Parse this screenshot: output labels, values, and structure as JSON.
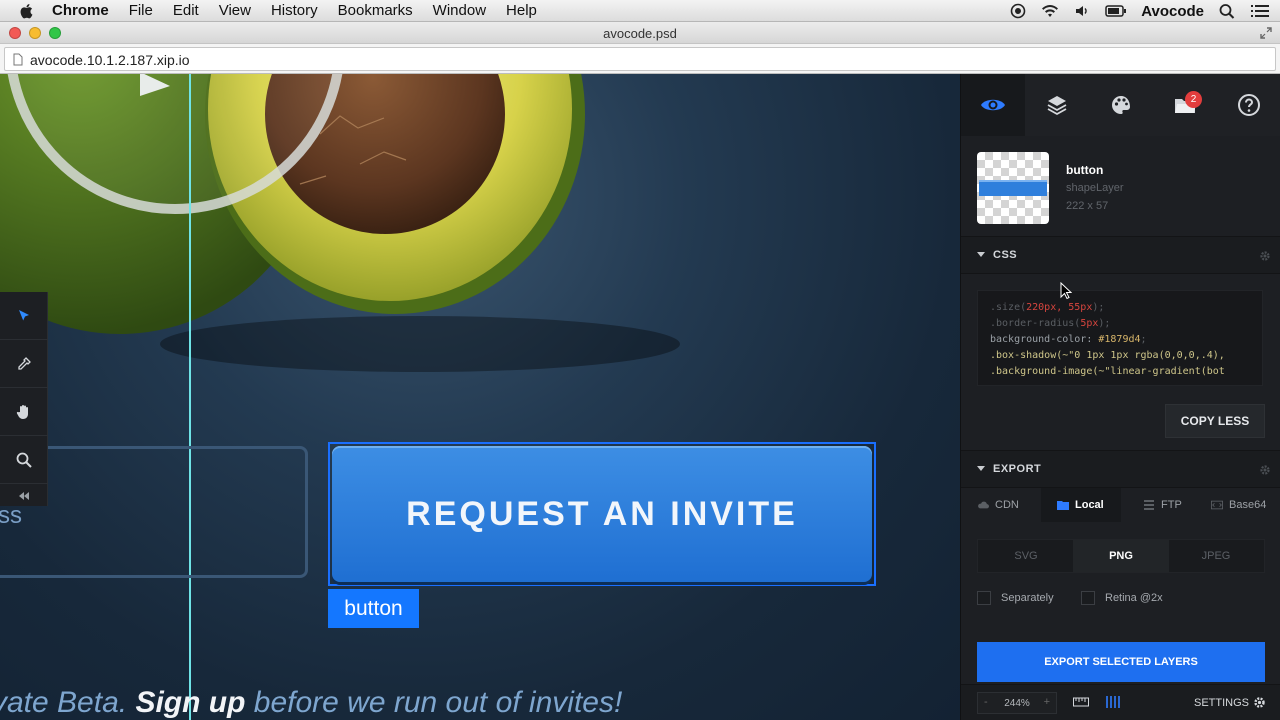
{
  "menubar": {
    "app_name": "Chrome",
    "items": [
      "File",
      "Edit",
      "View",
      "History",
      "Bookmarks",
      "Window",
      "Help"
    ],
    "user_name": "Avocode",
    "tray_icons": [
      "screen-record-icon",
      "wifi-icon",
      "volume-icon",
      "battery-icon",
      "search-icon",
      "list-icon"
    ]
  },
  "window": {
    "title": "avocode.psd",
    "url": "avocode.10.1.2.187.xip.io"
  },
  "canvas": {
    "input_partial_text": "ss",
    "button_label": "REQUEST AN INVITE",
    "selected_layer_tag": "button",
    "promo_prefix": "vate Beta. ",
    "promo_strong": "Sign up",
    "promo_suffix": " before we run out of invites!",
    "accent_color": "#1477ff",
    "guide_color": "#6fe3e6"
  },
  "inspector": {
    "tabs": [
      "eye-icon",
      "layers-icon",
      "palette-icon",
      "folder-icon",
      "help-icon"
    ],
    "folder_badge": "2",
    "layer": {
      "name": "button",
      "type": "shapeLayer",
      "size": "222 x 57"
    },
    "css_section": {
      "title": "CSS",
      "code": [
        {
          "a": ".size(",
          "b": "220px, 55px",
          "c": ");"
        },
        {
          "a": ".border-radius(",
          "b": "5px",
          "c": ");"
        },
        {
          "a": "background-color: ",
          "b": "#1879d4",
          "c": ";"
        },
        {
          "a": ".box-shadow(~\"0 1px 1px rgba(0,0,0,.4),",
          "b": "",
          "c": ""
        },
        {
          "a": ".background-image(~\"linear-gradient(bot",
          "b": "",
          "c": ""
        }
      ],
      "copy_button": "COPY LESS"
    },
    "export_section": {
      "title": "EXPORT",
      "targets": [
        "CDN",
        "Local",
        "FTP",
        "Base64"
      ],
      "active_target": "Local",
      "formats": [
        "SVG",
        "PNG",
        "JPEG"
      ],
      "active_format": "PNG",
      "options": [
        "Separately",
        "Retina @2x"
      ],
      "export_button": "EXPORT SELECTED LAYERS"
    },
    "bottom": {
      "zoom": "244%",
      "zoom_minus": "-",
      "zoom_plus": "+",
      "settings_label": "SETTINGS"
    }
  }
}
